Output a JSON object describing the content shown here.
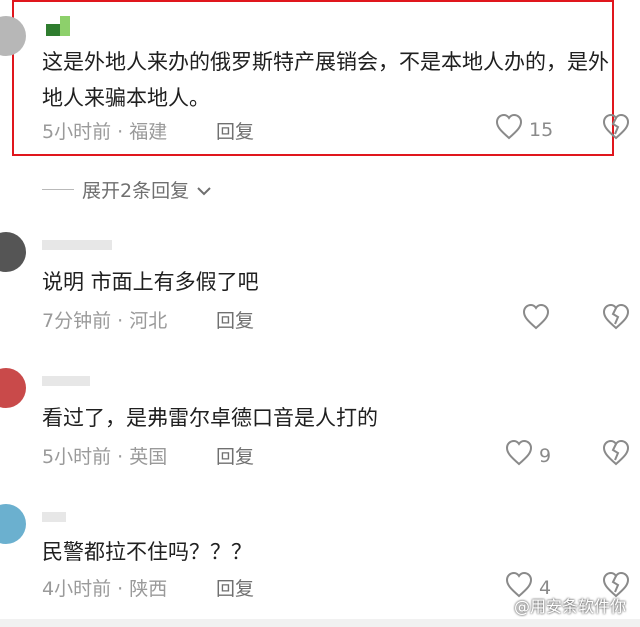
{
  "comments": [
    {
      "username": "",
      "text": "这是外地人来办的俄罗斯特产展销会，不是本地人办的，是外地人来骗本地人。",
      "time": "5小时前",
      "location": "福建",
      "reply_label": "回复",
      "likes": "15",
      "highlighted": true
    },
    {
      "username": "",
      "text": "说明 市面上有多假了吧",
      "time": "7分钟前",
      "location": "河北",
      "reply_label": "回复",
      "likes": ""
    },
    {
      "username": "",
      "text": "看过了，是弗雷尔卓德口音是人打的",
      "time": "5小时前",
      "location": "英国",
      "reply_label": "回复",
      "likes": "9"
    },
    {
      "username": "",
      "text": "民警都拉不住吗？？？",
      "time": "4小时前",
      "location": "陕西",
      "reply_label": "回复",
      "likes": "4"
    }
  ],
  "expand_replies": "展开2条回复",
  "watermark": "@用安条软件你",
  "colors": {
    "highlight_border": "#e0161d",
    "meta_text": "#9a9a9a",
    "icon_stroke": "#8a8a8a"
  },
  "icons": [
    "heart-icon",
    "broken-heart-icon",
    "chevron-down-icon"
  ]
}
